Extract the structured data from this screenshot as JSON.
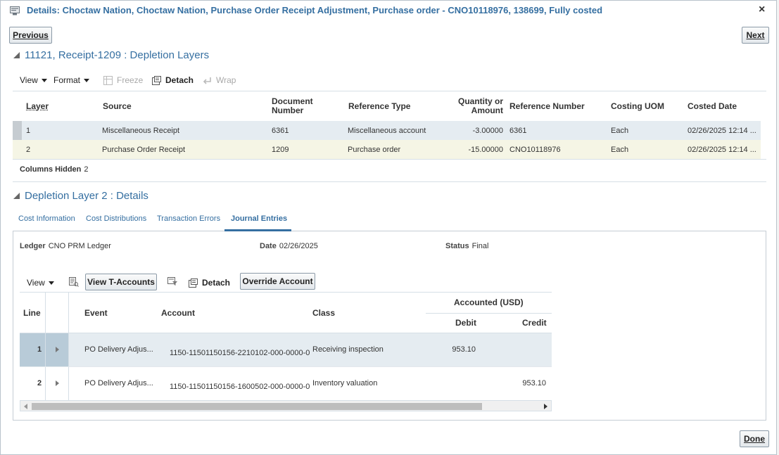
{
  "dialog": {
    "title": "Details: Choctaw Nation, Choctaw Nation, Purchase Order Receipt Adjustment, Purchase order - CNO10118976, 138699, Fully costed",
    "close": "×",
    "prev_label": "Previous",
    "next_label": "Next",
    "done_label": "Done"
  },
  "layers_section": {
    "title": "11121, Receipt-1209 : Depletion Layers",
    "toolbar": {
      "view": "View",
      "format": "Format",
      "freeze": "Freeze",
      "detach": "Detach",
      "wrap": "Wrap"
    },
    "columns": [
      "Layer",
      "Source",
      "Document Number",
      "Reference Type",
      "Quantity or Amount",
      "Reference Number",
      "Costing UOM",
      "Costed Date"
    ],
    "rows": [
      {
        "layer": "1",
        "source": "Miscellaneous Receipt",
        "doc": "6361",
        "ref_type": "Miscellaneous account",
        "qty": "-3.00000",
        "ref_num": "6361",
        "uom": "Each",
        "date": "02/26/2025 12:14 ..."
      },
      {
        "layer": "2",
        "source": "Purchase Order Receipt",
        "doc": "1209",
        "ref_type": "Purchase order",
        "qty": "-15.00000",
        "ref_num": "CNO10118976",
        "uom": "Each",
        "date": "02/26/2025 12:14 ..."
      }
    ],
    "columns_hidden_label": "Columns Hidden",
    "columns_hidden_value": "2"
  },
  "details_section": {
    "title": "Depletion Layer 2 : Details",
    "tabs": [
      "Cost Information",
      "Cost Distributions",
      "Transaction Errors",
      "Journal Entries"
    ],
    "active_tab": "Journal Entries",
    "ledger_label": "Ledger",
    "ledger_value": "CNO PRM Ledger",
    "date_label": "Date",
    "date_value": "02/26/2025",
    "status_label": "Status",
    "status_value": "Final",
    "toolbar": {
      "view": "View",
      "view_t_accounts": "View T-Accounts",
      "detach": "Detach",
      "override_account": "Override Account"
    },
    "columns": {
      "line": "Line",
      "event": "Event",
      "account": "Account",
      "class": "Class",
      "accounted": "Accounted (USD)",
      "debit": "Debit",
      "credit": "Credit"
    },
    "rows": [
      {
        "line": "1",
        "event": "PO Delivery Adjus...",
        "account": "1150-11501150156-2210102-000-0000-0(",
        "class": "Receiving inspection",
        "debit": "953.10",
        "credit": ""
      },
      {
        "line": "2",
        "event": "PO Delivery Adjus...",
        "account": "1150-11501150156-1600502-000-0000-0(",
        "class": "Inventory valuation",
        "debit": "",
        "credit": "953.10"
      }
    ]
  },
  "colors": {
    "accent": "#356fa1",
    "selected_row": "#e5ecf1",
    "highlight_row": "#f5f5e5"
  }
}
